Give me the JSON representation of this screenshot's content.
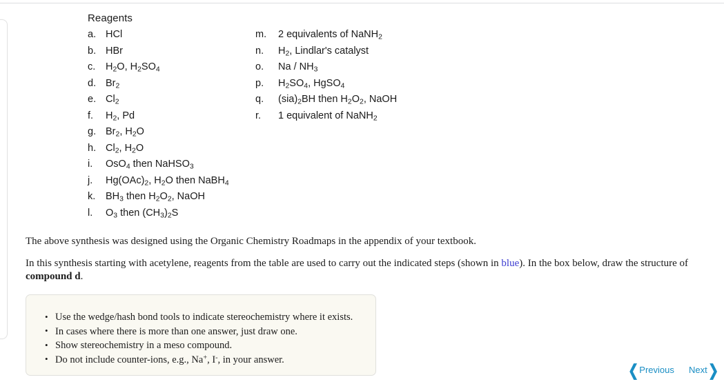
{
  "reagents": {
    "title": "Reagents",
    "left_column": [
      {
        "key": "a.",
        "value": "HCl"
      },
      {
        "key": "b.",
        "value": "HBr"
      },
      {
        "key": "c.",
        "value": "H2O, H2SO4"
      },
      {
        "key": "d.",
        "value": "Br2"
      },
      {
        "key": "e.",
        "value": "Cl2"
      },
      {
        "key": "f.",
        "value": "H2, Pd"
      },
      {
        "key": "g.",
        "value": "Br2, H2O"
      },
      {
        "key": "h.",
        "value": "Cl2, H2O"
      },
      {
        "key": "i.",
        "value": "OsO4 then NaHSO3"
      },
      {
        "key": "j.",
        "value": "Hg(OAc)2, H2O then NaBH4"
      },
      {
        "key": "k.",
        "value": "BH3 then H2O2, NaOH"
      },
      {
        "key": "l.",
        "value": "O3 then (CH3)2S"
      }
    ],
    "right_column": [
      {
        "key": "m.",
        "value": "2 equivalents of NaNH2"
      },
      {
        "key": "n.",
        "value": "H2, Lindlar's catalyst"
      },
      {
        "key": "o.",
        "value": "Na / NH3"
      },
      {
        "key": "p.",
        "value": "H2SO4, HgSO4"
      },
      {
        "key": "q.",
        "value": "(sia)2BH then H2O2, NaOH"
      },
      {
        "key": "r.",
        "value": "1 equivalent of NaNH2"
      }
    ]
  },
  "paragraphs": {
    "roadmap": "The above synthesis was designed using the Organic Chemistry Roadmaps in the appendix of your textbook.",
    "synthesis_part1": "In this synthesis starting with acetylene, reagents from the table are used to carry out the indicated steps (shown in ",
    "synthesis_blue_word": "blue",
    "synthesis_part2": "). In the box below, draw the structure of ",
    "synthesis_bold": "compound d",
    "synthesis_part3": "."
  },
  "instructions": {
    "bullet1": "Use the wedge/hash bond tools to indicate stereochemistry where it exists.",
    "bullet2": "In cases where there is more than one answer, just draw one.",
    "bullet3": "Show stereochemistry in a meso compound.",
    "bullet4_part1": "Do not include counter-ions, e.g., Na",
    "bullet4_sup1": "+",
    "bullet4_part2": ", I",
    "bullet4_sup2": "-",
    "bullet4_part3": ", in your answer."
  },
  "navigation": {
    "previous_label": "Previous",
    "next_label": "Next",
    "chevron_left": "❮",
    "chevron_right": "❯",
    "accent_color": "#1a8ec4"
  },
  "colors": {
    "blue_link": "#3b3bd0",
    "nav_blue": "#1a8ec4",
    "box_background": "#faf9f2",
    "box_border": "#e0e0dc",
    "rule": "#dcdde0"
  }
}
